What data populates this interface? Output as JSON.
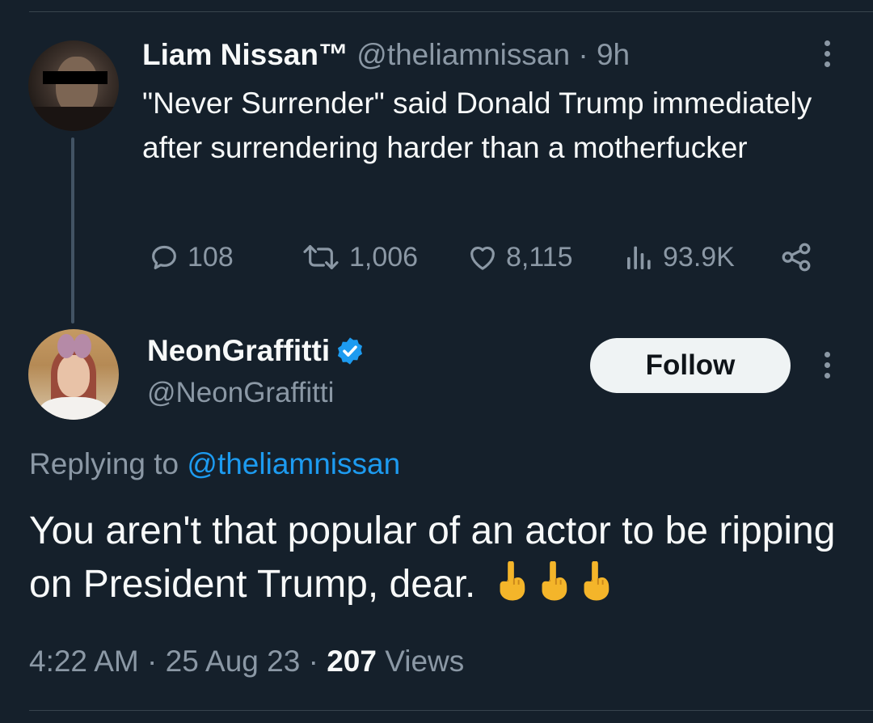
{
  "original_tweet": {
    "display_name": "Liam Nissan™",
    "handle": "@theliamnissan",
    "separator": " · ",
    "time_ago": "9h",
    "text": "\"Never Surrender\" said Donald Trump immediately after surrendering harder than a motherfucker",
    "stats": {
      "replies": "108",
      "retweets": "1,006",
      "likes": "8,115",
      "views": "93.9K"
    }
  },
  "reply_tweet": {
    "display_name": "NeonGraffitti",
    "handle": "@NeonGraffitti",
    "follow_label": "Follow",
    "replying_prefix": "Replying to ",
    "replying_to": "@theliamnissan",
    "text": "You aren't that popular of an actor to be ripping on President Trump, dear.",
    "emojis": "🖕🖕🖕",
    "timestamp": "4:22 AM",
    "date": "25 Aug 23",
    "dot": " · ",
    "views_count": "207",
    "views_label": " Views"
  },
  "colors": {
    "background": "#15202b",
    "text": "#f7f9f9",
    "muted": "#8b98a5",
    "link": "#1d9bf0",
    "verified": "#1d9bf0",
    "follow_bg": "#eff3f4"
  },
  "icons": [
    "more-icon",
    "reply-icon",
    "retweet-icon",
    "like-icon",
    "views-icon",
    "share-icon",
    "verified-badge-icon",
    "middle-finger-emoji"
  ]
}
